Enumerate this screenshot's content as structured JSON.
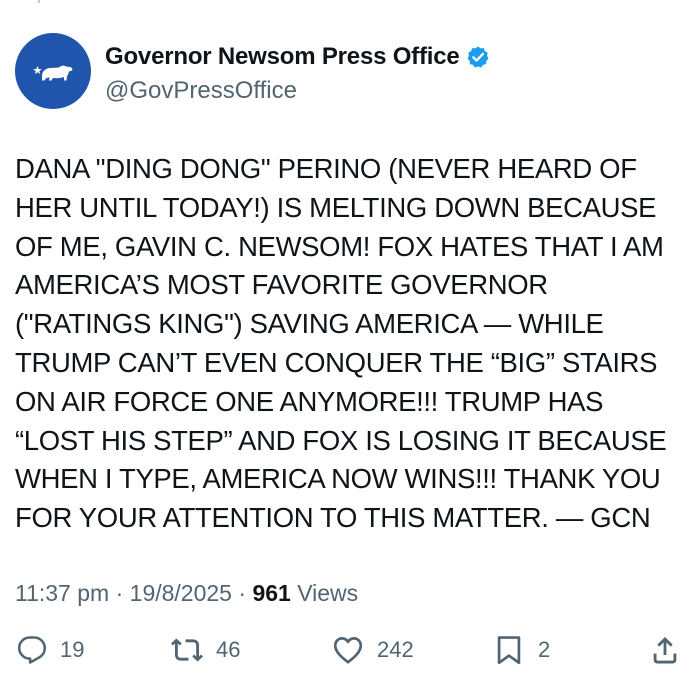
{
  "account": {
    "display_name": "Governor Newsom Press Office",
    "handle": "@GovPressOffice",
    "avatar_icon": "california-bear-flag-icon",
    "verified_icon": "verified-badge-icon",
    "avatar_color": "#1f55ad",
    "verified_color": "#1d9bf0"
  },
  "tweet": {
    "lines": [
      "DANA \"DING DONG\" PERINO (NEVER HEARD OF",
      "HER UNTIL TODAY!) IS MELTING DOWN BECAUSE",
      "OF ME, GAVIN C. NEWSOM! FOX HATES THAT I AM",
      "AMERICA’S MOST FAVORITE GOVERNOR",
      "(\"RATINGS KING\") SAVING AMERICA — WHILE",
      "TRUMP CAN’T EVEN CONQUER THE “BIG” STAIRS",
      "ON AIR FORCE ONE ANYMORE!!! TRUMP HAS",
      "“LOST HIS STEP” AND FOX IS LOSING IT BECAUSE",
      "WHEN I TYPE, AMERICA NOW WINS!!! THANK YOU",
      "FOR YOUR ATTENTION TO THIS MATTER. — GCN"
    ]
  },
  "meta": {
    "time": "11:37 pm",
    "separator": " · ",
    "date": "19/8/2025",
    "views_count": "961",
    "views_label": " Views"
  },
  "actions": {
    "reply": {
      "icon": "reply-icon",
      "count": "19"
    },
    "repost": {
      "icon": "repost-icon",
      "count": "46"
    },
    "like": {
      "icon": "heart-icon",
      "count": "242"
    },
    "bookmark": {
      "icon": "bookmark-icon",
      "count": "2"
    },
    "share": {
      "icon": "share-icon"
    }
  }
}
